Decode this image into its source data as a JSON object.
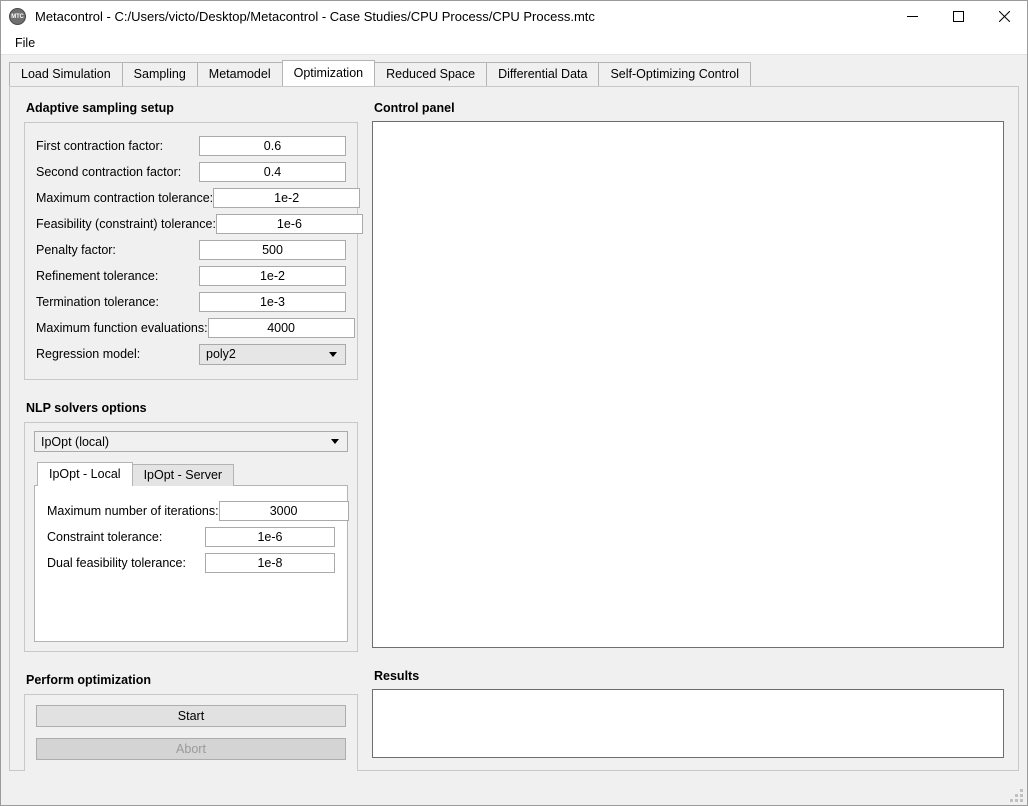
{
  "window": {
    "title": "Metacontrol - C:/Users/victo/Desktop/Metacontrol - Case Studies/CPU Process/CPU Process.mtc",
    "logo_text": "MTC",
    "logo_icon": "app-logo-icon",
    "controls": {
      "minimize": "minimize-icon",
      "maximize": "maximize-icon",
      "close": "close-icon"
    }
  },
  "menubar": {
    "items": [
      {
        "label": "File"
      }
    ]
  },
  "tabs": [
    {
      "label": "Load Simulation",
      "active": false
    },
    {
      "label": "Sampling",
      "active": false
    },
    {
      "label": "Metamodel",
      "active": false
    },
    {
      "label": "Optimization",
      "active": true
    },
    {
      "label": "Reduced Space",
      "active": false
    },
    {
      "label": "Differential Data",
      "active": false
    },
    {
      "label": "Self-Optimizing Control",
      "active": false
    }
  ],
  "adaptive_sampling": {
    "title": "Adaptive sampling setup",
    "fields": [
      {
        "label": "First contraction factor:",
        "value": "0.6"
      },
      {
        "label": "Second contraction factor:",
        "value": "0.4"
      },
      {
        "label": "Maximum contraction tolerance:",
        "value": "1e-2"
      },
      {
        "label": "Feasibility (constraint) tolerance:",
        "value": "1e-6"
      },
      {
        "label": "Penalty factor:",
        "value": "500"
      },
      {
        "label": "Refinement tolerance:",
        "value": "1e-2"
      },
      {
        "label": "Termination tolerance:",
        "value": "1e-3"
      },
      {
        "label": "Maximum function evaluations:",
        "value": "4000"
      }
    ],
    "regression": {
      "label": "Regression model:",
      "value": "poly2",
      "arrow_icon": "chevron-down-icon"
    }
  },
  "nlp_solvers": {
    "title": "NLP solvers options",
    "solver": {
      "value": "IpOpt (local)",
      "arrow_icon": "chevron-down-icon"
    },
    "tabs": [
      {
        "label": "IpOpt - Local",
        "active": true
      },
      {
        "label": "IpOpt - Server",
        "active": false
      }
    ],
    "fields": [
      {
        "label": "Maximum number of iterations:",
        "value": "3000"
      },
      {
        "label": "Constraint tolerance:",
        "value": "1e-6"
      },
      {
        "label": "Dual feasibility tolerance:",
        "value": "1e-8"
      }
    ]
  },
  "perform_optimization": {
    "title": "Perform optimization",
    "start_label": "Start",
    "abort_label": "Abort"
  },
  "control_panel": {
    "title": "Control panel",
    "content": ""
  },
  "results": {
    "title": "Results",
    "content": ""
  },
  "statusbar": {
    "text": "",
    "grip_icon": "resize-grip-icon"
  },
  "colors": {
    "window_bg": "#f0f0f0",
    "pane_bg": "#ffffff",
    "border": "#c8c8c8",
    "panel_border": "#6e6e6e",
    "disabled_text": "#9a9a9a"
  }
}
